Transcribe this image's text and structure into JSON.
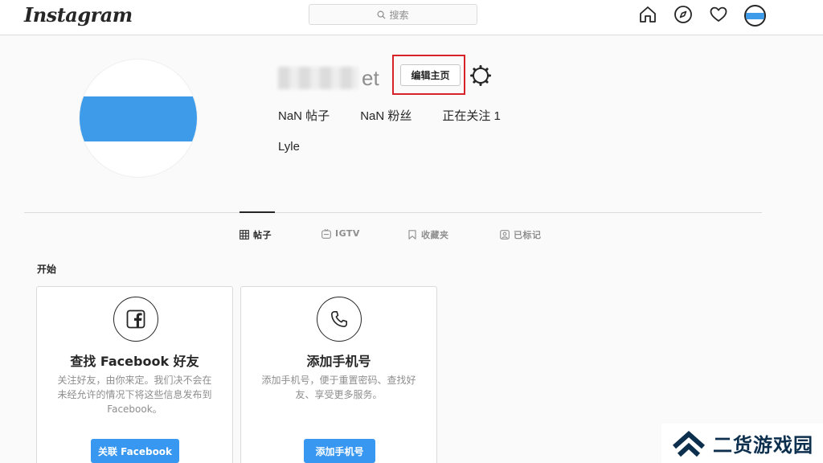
{
  "nav": {
    "logo": "Instagram",
    "search_placeholder": "搜索",
    "icons": [
      "home-icon",
      "explore-icon",
      "heart-icon",
      "avatar"
    ]
  },
  "profile": {
    "username_visible_suffix": "et",
    "edit_button": "编辑主页",
    "stats": {
      "posts": "NaN 帖子",
      "followers": "NaN 粉丝",
      "following": "正在关注 1"
    },
    "full_name": "Lyle",
    "avatar_colors": {
      "band": "#3d9be9",
      "background": "#ffffff"
    }
  },
  "tabs": [
    {
      "label": "帖子",
      "icon": "grid-icon",
      "active": true
    },
    {
      "label": "IGTV",
      "icon": "igtv-icon",
      "active": false
    },
    {
      "label": "收藏夹",
      "icon": "bookmark-icon",
      "active": false
    },
    {
      "label": "已标记",
      "icon": "tagged-icon",
      "active": false
    }
  ],
  "getting_started": {
    "title": "开始",
    "cards": [
      {
        "icon": "facebook-icon",
        "title": "查找 Facebook 好友",
        "description_lines": [
          "关注好友，由你来定。我们决不会在",
          "未经允许的情况下将这些信息发布到",
          "Facebook。"
        ],
        "button": "关联 Facebook"
      },
      {
        "icon": "phone-icon",
        "title": "添加手机号",
        "description_lines": [
          "添加手机号，便于重置密码、查找好",
          "友、享受更多服务。"
        ],
        "button": "添加手机号"
      }
    ]
  },
  "watermark": {
    "text": "二货游戏园"
  },
  "colors": {
    "highlight": "#d6232a",
    "primary_button": "#3897f0"
  }
}
